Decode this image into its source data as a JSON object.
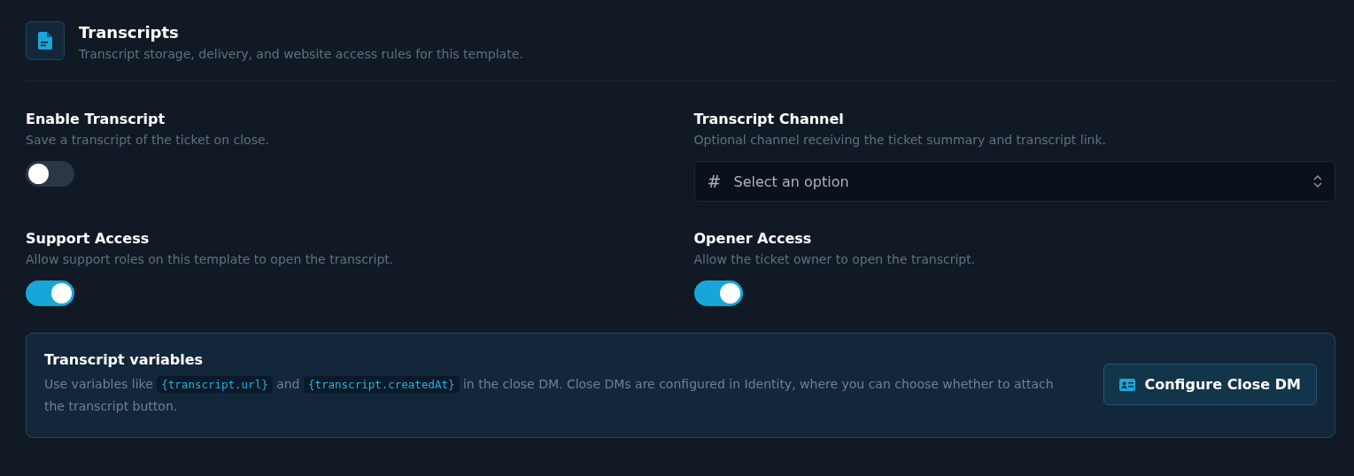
{
  "section": {
    "title": "Transcripts",
    "subtitle": "Transcript storage, delivery, and website access rules for this template."
  },
  "fields": [
    {
      "kind": "toggle",
      "label": "Enable Transcript",
      "description": "Save a transcript of the ticket on close.",
      "on": false
    },
    {
      "kind": "select",
      "label": "Transcript Channel",
      "description": "Optional channel receiving the ticket summary and transcript link.",
      "prefix": "#",
      "placeholder": "Select an option"
    },
    {
      "kind": "toggle",
      "label": "Support Access",
      "description": "Allow support roles on this template to open the transcript.",
      "on": true
    },
    {
      "kind": "toggle",
      "label": "Opener Access",
      "description": "Allow the ticket owner to open the transcript.",
      "on": true
    }
  ],
  "info_card": {
    "title": "Transcript variables",
    "body": [
      {
        "kind": "text",
        "text": "Use variables like "
      },
      {
        "kind": "code",
        "text": "{transcript.url}"
      },
      {
        "kind": "text",
        "text": " and "
      },
      {
        "kind": "code",
        "text": "{transcript.createdAt}"
      },
      {
        "kind": "text",
        "text": " in the close DM. Close DMs are configured in Identity, where you can choose whether to attach the transcript button."
      }
    ],
    "button": "Configure Close DM"
  }
}
